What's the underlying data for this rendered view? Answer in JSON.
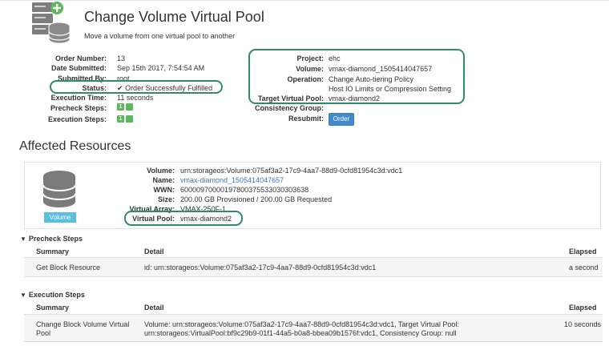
{
  "header": {
    "title": "Change Volume Virtual Pool",
    "subtitle": "Move a volume from one virtual pool to another"
  },
  "order": {
    "left": [
      {
        "label": "Order Number:",
        "value": "13"
      },
      {
        "label": "Date Submitted:",
        "value": "Sep 15th 2017, 7:54:54 AM"
      },
      {
        "label": "Submitted By:",
        "value": "root"
      },
      {
        "label": "Status:",
        "value": "Order Successfully Fulfilled",
        "icon": "checkmark-icon"
      },
      {
        "label": "Execution Time:",
        "value": "11 seconds"
      },
      {
        "label": "Precheck Steps:",
        "value": "1"
      },
      {
        "label": "Execution Steps:",
        "value": "1"
      }
    ],
    "right": [
      {
        "label": "Project:",
        "value": "ehc"
      },
      {
        "label": "Volume:",
        "value": "vmax-diamond_1505414047657"
      },
      {
        "label": "Operation:",
        "value": "Change Auto-tiering Policy"
      },
      {
        "label": "",
        "value": "Host IO Limits or Compression Setting"
      },
      {
        "label": "Target Virtual Pool:",
        "value": "vmax-diamond2"
      },
      {
        "label": "Consistency Group:",
        "value": ""
      },
      {
        "label": "Resubmit:",
        "value": ""
      }
    ],
    "resubmit_button": "Order"
  },
  "affected": {
    "title": "Affected Resources",
    "badge": "Volume",
    "fields": [
      {
        "label": "Volume:",
        "value": "urn:storageos:Volume:075af3a2-17c9-4aa7-88d9-0cfd81954c3d:vdc1"
      },
      {
        "label": "Name:",
        "value": "vmax-diamond_1505414047657"
      },
      {
        "label": "WWN:",
        "value": "60000970000197800375533030303638"
      },
      {
        "label": "Size:",
        "value": "200.00 GB Provisioned / 200.00 GB Requested"
      },
      {
        "label": "Virtual Array:",
        "value": "VMAX-250F-1"
      },
      {
        "label": "Virtual Pool:",
        "value": "vmax-diamond2"
      }
    ]
  },
  "precheck": {
    "title": "Precheck Steps",
    "columns": [
      "Summary",
      "Detail",
      "Elapsed"
    ],
    "rows": [
      {
        "summary": "Get Block Resource",
        "detail": "id: urn:storageos:Volume:075af3a2-17c9-4aa7-88d9-0cfd81954c3d:vdc1",
        "elapsed": "a second"
      }
    ]
  },
  "execution": {
    "title": "Execution Steps",
    "columns": [
      "Summary",
      "Detail",
      "Elapsed"
    ],
    "rows": [
      {
        "summary_line1": "Change Block Volume Virtual",
        "summary_line2": "Pool",
        "detail_line1": "Volume: urn:storageos:Volume:075af3a2-17c9-4aa7-88d9-0cfd81954c3d:vdc1, Target Virtual Pool:",
        "detail_line2": "urn:storageos:VirtualPool:bf9c29b9-01f1-44a5-b0a8-bbea09b1576f:vdc1, Consistency Group: null",
        "elapsed": "10 seconds"
      }
    ]
  },
  "colors": {
    "accent": "#428bca",
    "success": "#5cb85c",
    "badge": "#5bc0de",
    "highlight_ring": "#2e8b6e",
    "link": "#3a78c3"
  }
}
